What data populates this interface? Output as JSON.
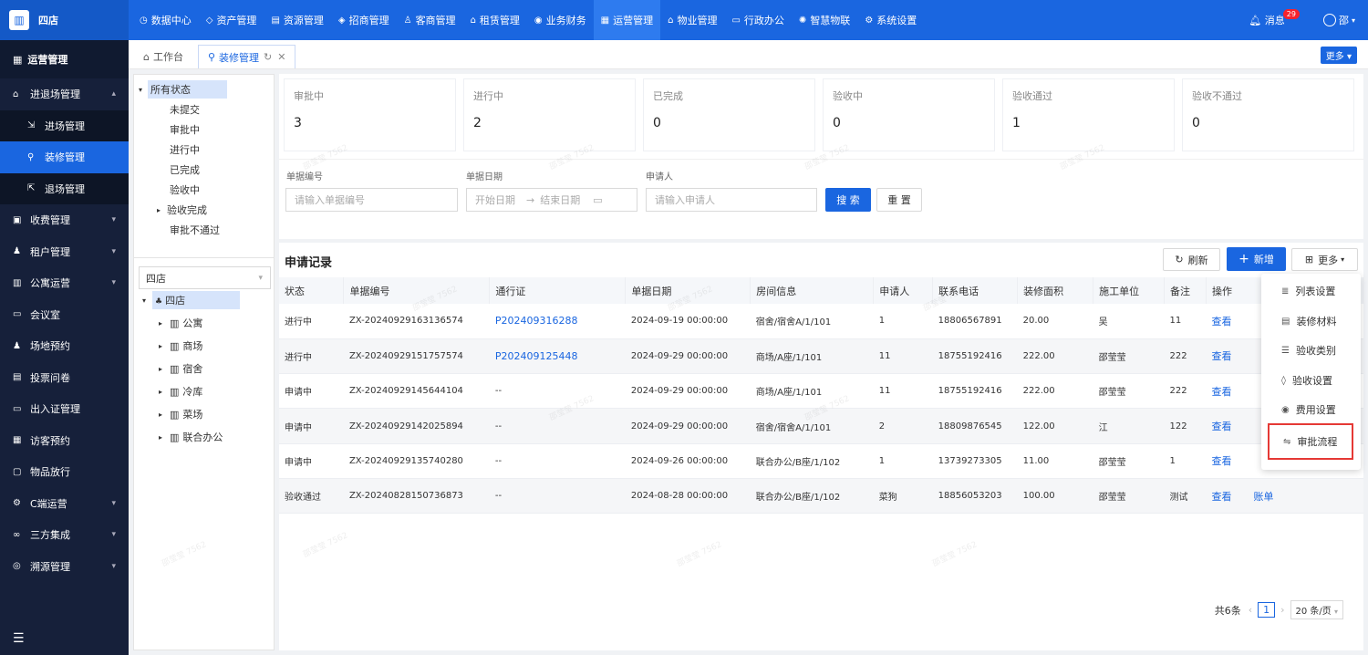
{
  "brand": {
    "name": "四店",
    "logo_icon": "building-icon"
  },
  "nav": {
    "items": [
      {
        "label": "数据中心",
        "icon": "clock-icon"
      },
      {
        "label": "资产管理",
        "icon": "cube-icon"
      },
      {
        "label": "资源管理",
        "icon": "grid-icon"
      },
      {
        "label": "招商管理",
        "icon": "tag-icon"
      },
      {
        "label": "客商管理",
        "icon": "users-icon"
      },
      {
        "label": "租赁管理",
        "icon": "home-icon"
      },
      {
        "label": "业务财务",
        "icon": "coin-icon"
      },
      {
        "label": "运营管理",
        "icon": "chart-icon",
        "active": true
      },
      {
        "label": "物业管理",
        "icon": "house-icon"
      },
      {
        "label": "行政办公",
        "icon": "doc-icon"
      },
      {
        "label": "智慧物联",
        "icon": "sun-icon"
      },
      {
        "label": "系统设置",
        "icon": "gear-icon"
      }
    ]
  },
  "topright": {
    "message_label": "消息",
    "message_count": "29",
    "user": "邵"
  },
  "sidebar": {
    "header": "运营管理",
    "items": [
      {
        "label": "进退场管理",
        "expanded": true
      },
      {
        "label": "进场管理",
        "sub": true
      },
      {
        "label": "装修管理",
        "sub": true,
        "active": true
      },
      {
        "label": "退场管理",
        "sub": true
      },
      {
        "label": "收费管理"
      },
      {
        "label": "租户管理"
      },
      {
        "label": "公寓运营"
      },
      {
        "label": "会议室"
      },
      {
        "label": "场地预约"
      },
      {
        "label": "投票问卷"
      },
      {
        "label": "出入证管理"
      },
      {
        "label": "访客预约"
      },
      {
        "label": "物品放行"
      },
      {
        "label": "C端运营"
      },
      {
        "label": "三方集成"
      },
      {
        "label": "溯源管理"
      }
    ]
  },
  "tabs": {
    "items": [
      {
        "label": "工作台"
      },
      {
        "label": "装修管理",
        "active": true
      }
    ],
    "more_label": "更多"
  },
  "status_tree": {
    "root": "所有状态",
    "children": [
      "未提交",
      "审批中",
      "进行中",
      "已完成",
      "验收中",
      "验收完成",
      "审批不通过"
    ]
  },
  "store_tree": {
    "selected": "四店",
    "root": "四店",
    "children": [
      "公寓",
      "商场",
      "宿舍",
      "冷库",
      "菜场",
      "联合办公"
    ]
  },
  "stats": [
    {
      "label": "审批中",
      "value": "3"
    },
    {
      "label": "进行中",
      "value": "2"
    },
    {
      "label": "已完成",
      "value": "0"
    },
    {
      "label": "验收中",
      "value": "0"
    },
    {
      "label": "验收通过",
      "value": "1"
    },
    {
      "label": "验收不通过",
      "value": "0"
    }
  ],
  "search": {
    "doc_no_label": "单据编号",
    "doc_no_placeholder": "请输入单据编号",
    "date_label": "单据日期",
    "start_placeholder": "开始日期",
    "end_placeholder": "结束日期",
    "applicant_label": "申请人",
    "applicant_placeholder": "请输入申请人",
    "search_btn": "搜 索",
    "reset_btn": "重 置"
  },
  "records": {
    "title": "申请记录",
    "refresh_btn": "刷新",
    "add_btn": "新增",
    "more_btn": "更多",
    "columns": [
      "状态",
      "单据编号",
      "通行证",
      "单据日期",
      "房间信息",
      "申请人",
      "联系电话",
      "装修面积",
      "施工单位",
      "备注",
      "操作"
    ],
    "rows": [
      {
        "status": "进行中",
        "no": "ZX-20240929163136574",
        "pass": "P202409316288",
        "date": "2024-09-19 00:00:00",
        "room": "宿舍/宿舍A/1/101",
        "applicant": "1",
        "phone": "18806567891",
        "area": "20.00",
        "unit": "吴",
        "note": "11",
        "op1": "查看",
        "op2": ""
      },
      {
        "status": "进行中",
        "no": "ZX-20240929151757574",
        "pass": "P202409125448",
        "date": "2024-09-29 00:00:00",
        "room": "商场/A座/1/101",
        "applicant": "11",
        "phone": "18755192416",
        "area": "222.00",
        "unit": "邵莹莹",
        "note": "222",
        "op1": "查看",
        "op2": ""
      },
      {
        "status": "申请中",
        "no": "ZX-20240929145644104",
        "pass": "--",
        "date": "2024-09-29 00:00:00",
        "room": "商场/A座/1/101",
        "applicant": "11",
        "phone": "18755192416",
        "area": "222.00",
        "unit": "邵莹莹",
        "note": "222",
        "op1": "查看",
        "op2": ""
      },
      {
        "status": "申请中",
        "no": "ZX-20240929142025894",
        "pass": "--",
        "date": "2024-09-29 00:00:00",
        "room": "宿舍/宿舍A/1/101",
        "applicant": "2",
        "phone": "18809876545",
        "area": "122.00",
        "unit": "江",
        "note": "122",
        "op1": "查看",
        "op2": ""
      },
      {
        "status": "申请中",
        "no": "ZX-20240929135740280",
        "pass": "--",
        "date": "2024-09-26 00:00:00",
        "room": "联合办公/B座/1/102",
        "applicant": "1",
        "phone": "13739273305",
        "area": "11.00",
        "unit": "邵莹莹",
        "note": "1",
        "op1": "查看",
        "op2": ""
      },
      {
        "status": "验收通过",
        "no": "ZX-20240828150736873",
        "pass": "--",
        "date": "2024-08-28 00:00:00",
        "room": "联合办公/B座/1/102",
        "applicant": "菜狗",
        "phone": "18856053203",
        "area": "100.00",
        "unit": "邵莹莹",
        "note": "测试",
        "op1": "查看",
        "op2": "账单"
      }
    ]
  },
  "pager": {
    "total": "共6条",
    "current": "1",
    "size": "20 条/页"
  },
  "more_menu": {
    "items": [
      {
        "label": "列表设置",
        "icon": "list-settings-icon"
      },
      {
        "label": "装修材料",
        "icon": "document-icon"
      },
      {
        "label": "验收类别",
        "icon": "bullet-list-icon"
      },
      {
        "label": "验收设置",
        "icon": "shield-icon"
      },
      {
        "label": "费用设置",
        "icon": "currency-icon"
      },
      {
        "label": "审批流程",
        "icon": "flow-icon",
        "highlighted": true
      }
    ]
  },
  "watermark": "邵莹莹 7562"
}
